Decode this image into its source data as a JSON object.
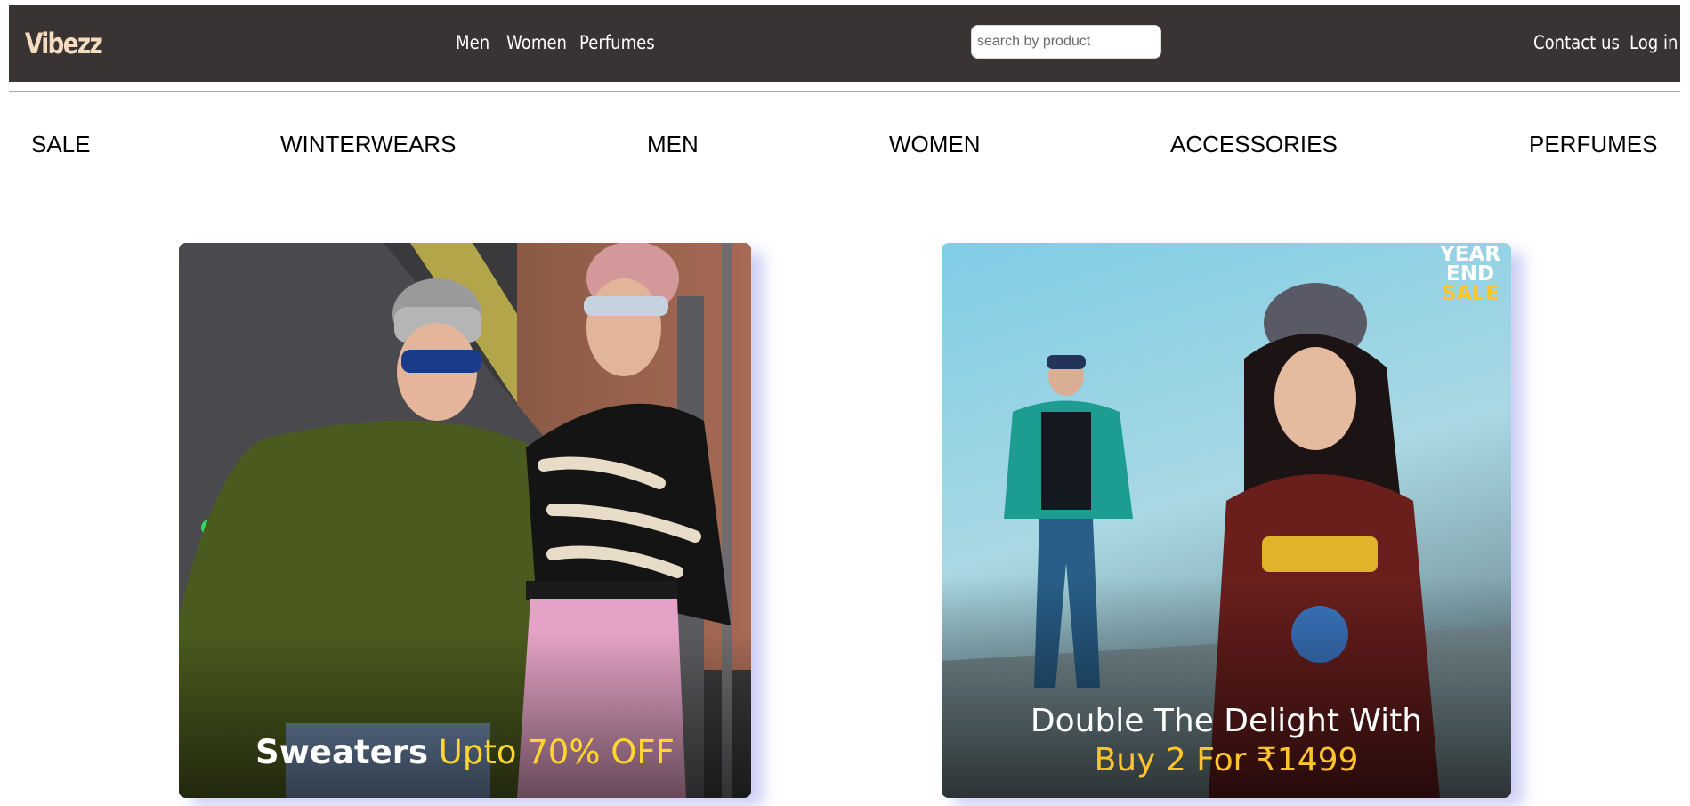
{
  "header": {
    "brand": "Vibezz",
    "nav": [
      "Men",
      "Women",
      "Perfumes"
    ],
    "search_placeholder": "search by product",
    "contact": "Contact us",
    "login": "Log in"
  },
  "categories": [
    "SALE",
    "WINTERWEARS",
    "MEN",
    "WOMEN",
    "ACCESSORIES",
    "PERFUMES"
  ],
  "banners": [
    {
      "caption_bold": "Sweaters",
      "caption_rest": "Upto 70% OFF"
    },
    {
      "badge": [
        "YEAR",
        "END",
        "SALE"
      ],
      "caption_line1": "Double The Delight With",
      "caption_line2": "Buy 2 For ₹1499"
    }
  ],
  "colors": {
    "header_bg": "#393433",
    "brand": "#f6dcbf",
    "offer_yellow": "#ffd52e"
  }
}
